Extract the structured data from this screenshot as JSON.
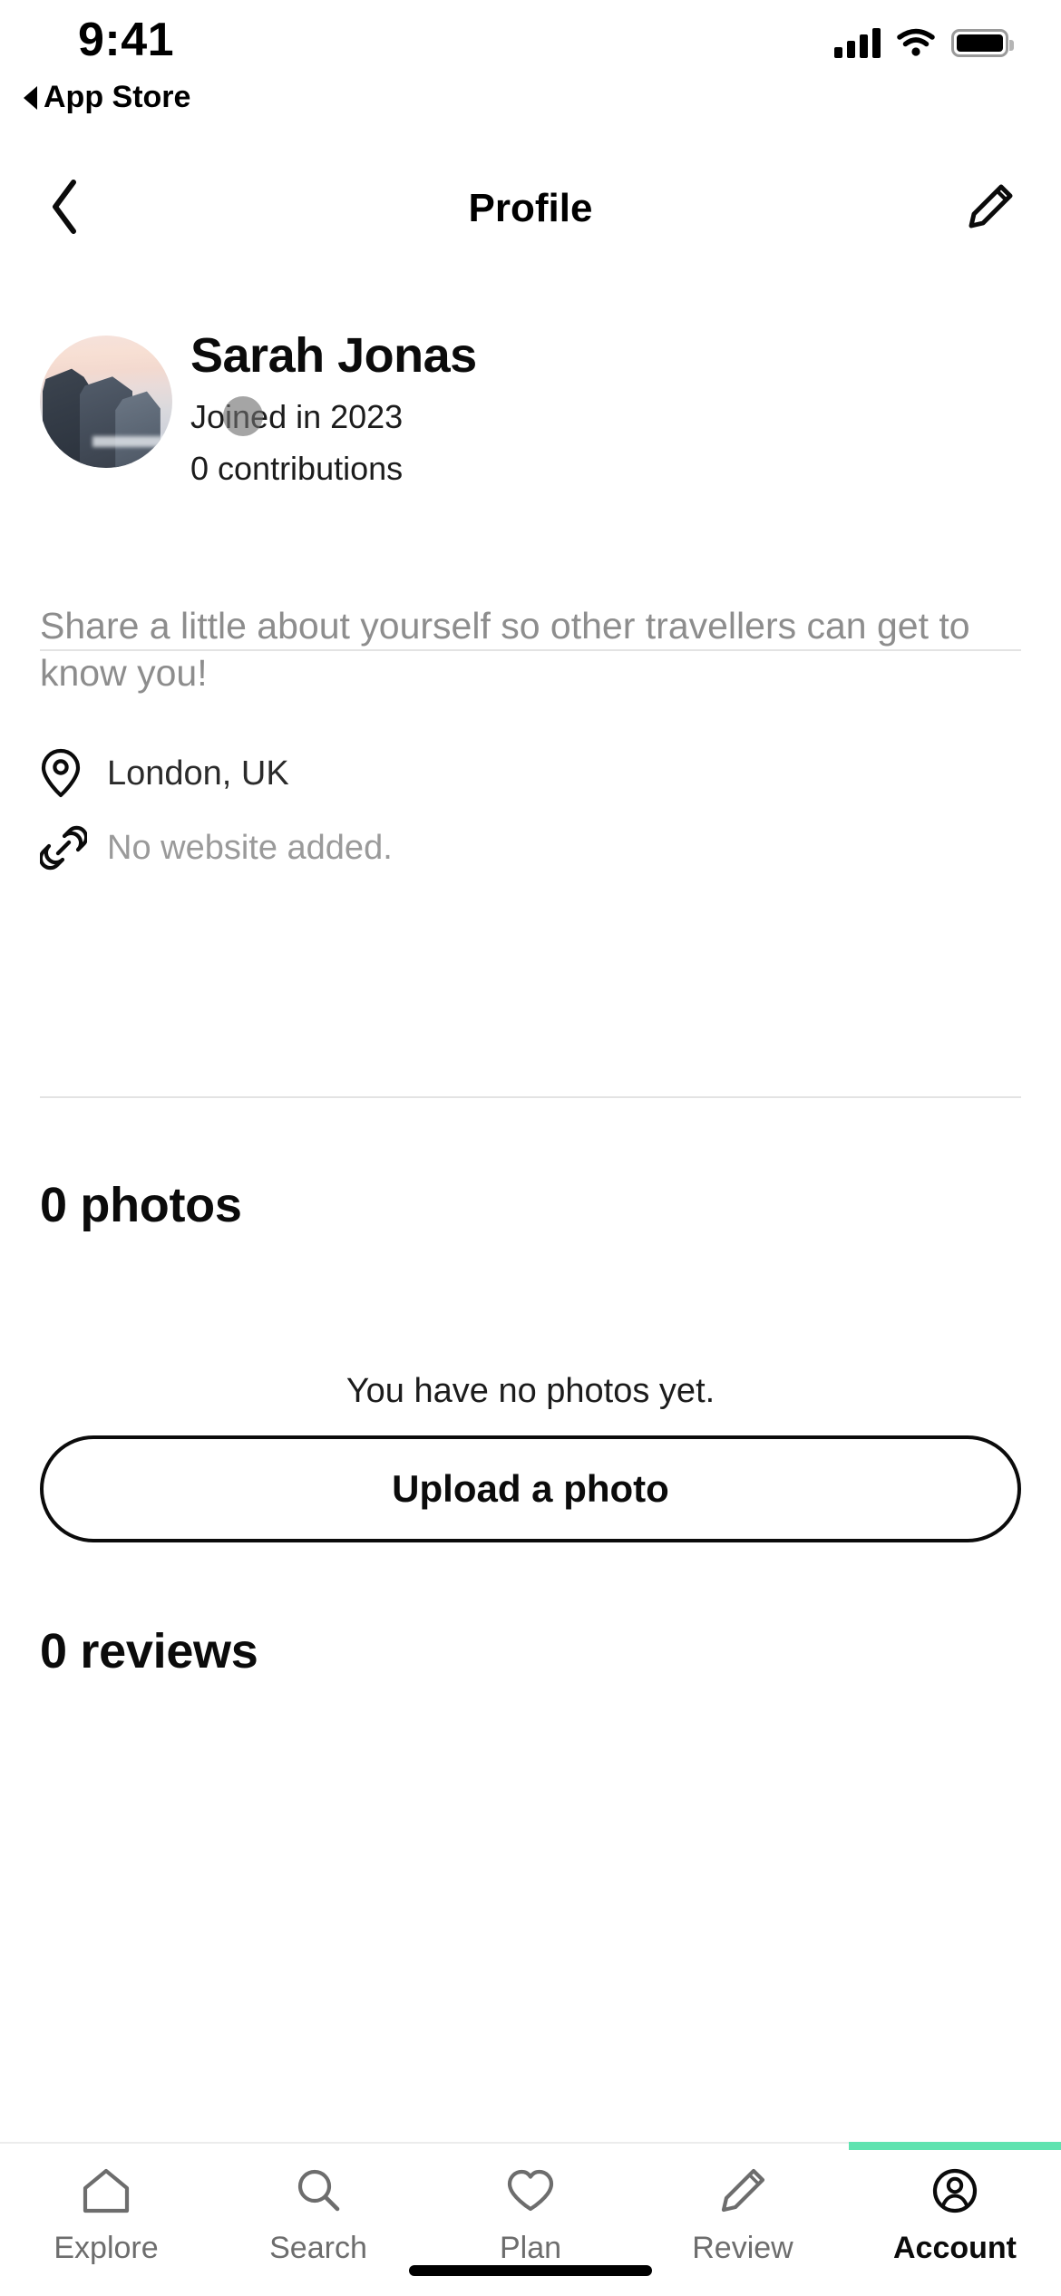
{
  "status_bar": {
    "time": "9:41",
    "back_app_label": "App Store",
    "icons": {
      "cellular": "signal-bars-icon",
      "wifi": "wifi-icon",
      "battery": "battery-icon"
    }
  },
  "nav_bar": {
    "title": "Profile",
    "back_icon": "chevron-left-icon",
    "edit_icon": "pencil-edit-icon"
  },
  "profile": {
    "avatar_alt": "sea-cliffs-photo",
    "name": "Sarah Jonas",
    "joined": "Joined in 2023",
    "contributions": "0 contributions",
    "bio_placeholder": "Share a little about yourself so other travellers can get to know you!",
    "location": {
      "icon": "map-pin-icon",
      "value": "London, UK"
    },
    "website": {
      "icon": "link-icon",
      "value": "No website added."
    }
  },
  "photos_section": {
    "heading": "0 photos",
    "empty_text": "You have no photos yet.",
    "upload_button": "Upload a photo"
  },
  "reviews_section": {
    "heading": "0 reviews"
  },
  "tab_bar": {
    "accent_color": "#5FE3B0",
    "items": [
      {
        "label": "Explore",
        "icon": "home-icon",
        "active": false
      },
      {
        "label": "Search",
        "icon": "search-icon",
        "active": false
      },
      {
        "label": "Plan",
        "icon": "heart-icon",
        "active": false
      },
      {
        "label": "Review",
        "icon": "pencil-icon",
        "active": false
      },
      {
        "label": "Account",
        "icon": "user-circle-icon",
        "active": true
      }
    ]
  }
}
